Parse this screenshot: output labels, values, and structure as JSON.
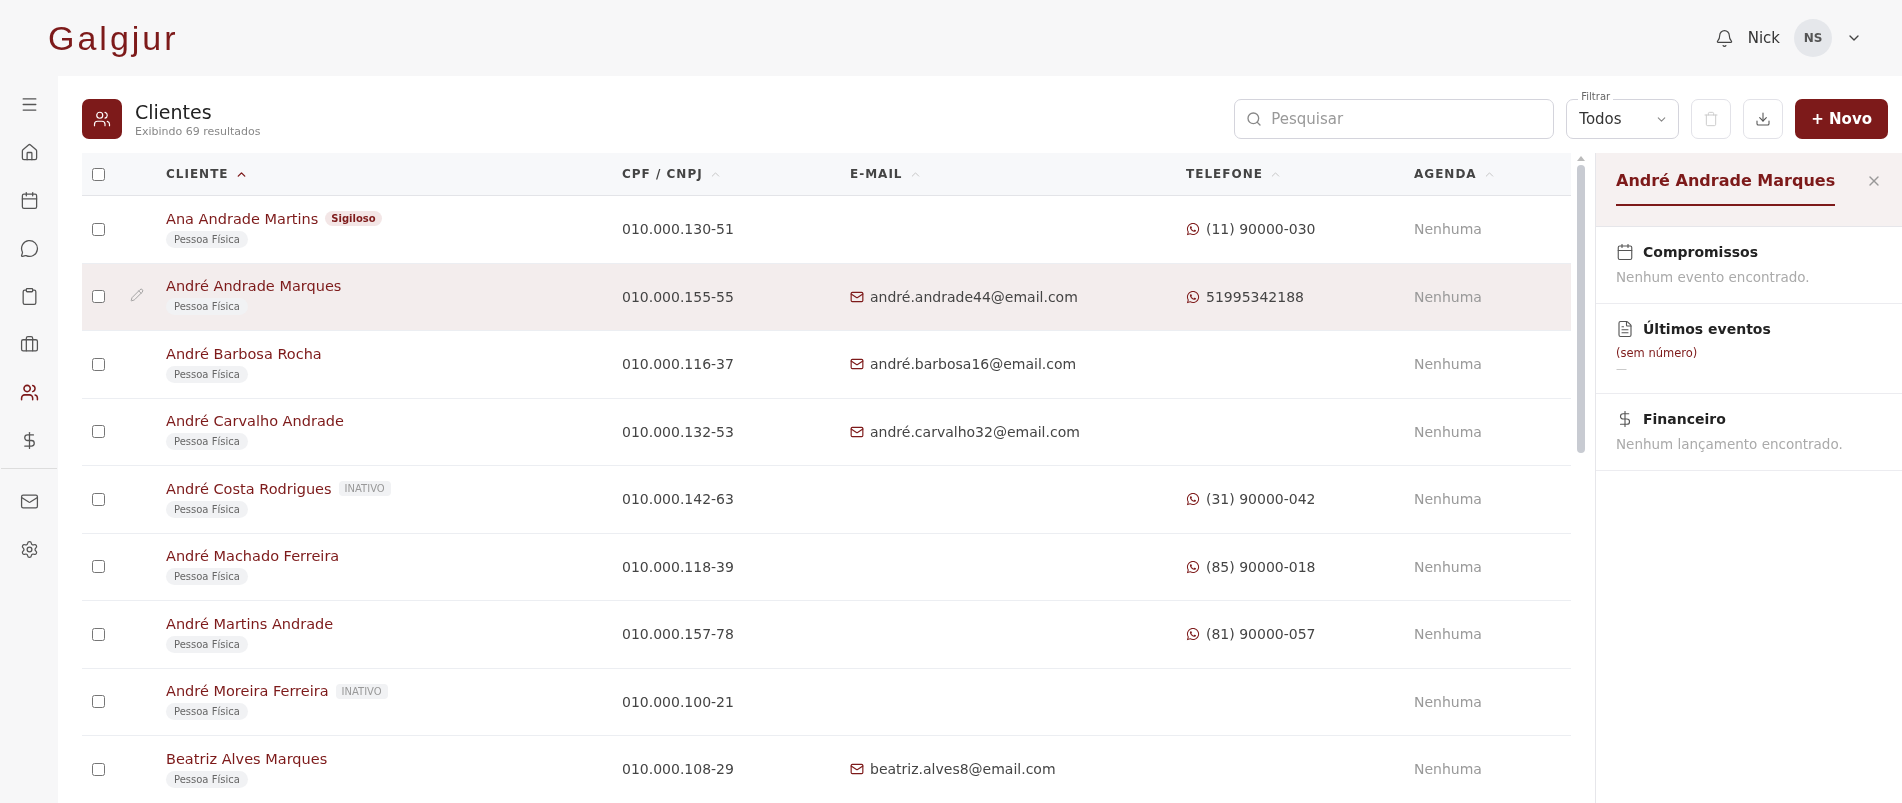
{
  "logo": "Galgjur",
  "user": {
    "name": "Nick",
    "initials": "NS"
  },
  "sidebar": {
    "items": [
      {
        "selected": false
      },
      {
        "selected": false
      },
      {
        "selected": false
      },
      {
        "selected": false
      },
      {
        "selected": false
      },
      {
        "selected": true
      },
      {
        "selected": false
      }
    ],
    "bottom_items": [
      {
        "selected": false
      },
      {
        "selected": false
      }
    ]
  },
  "page": {
    "title": "Clientes",
    "subtitle": "Exibindo 69 resultados"
  },
  "toolbar": {
    "search": {
      "placeholder": "Pesquisar"
    },
    "filter": {
      "label": "Filtrar",
      "value": "Todos"
    },
    "new_button": "+ Novo"
  },
  "table": {
    "select_all": {
      "checked": false
    },
    "columns": [
      {
        "label": "CLIENTE",
        "sorted": true
      },
      {
        "label": "CPF / CNPJ",
        "sorted": false
      },
      {
        "label": "E-MAIL",
        "sorted": false
      },
      {
        "label": "TELEFONE",
        "sorted": false
      },
      {
        "label": "AGENDA",
        "sorted": false
      }
    ],
    "rows": [
      {
        "name": "Ana Andrade Martins",
        "tag": {
          "kind": "sigiloso",
          "label": "Sigiloso"
        },
        "type": "Pessoa Física",
        "doc": "010.000.130-51",
        "phone": "(11) 90000-030",
        "agenda": "Nenhuma",
        "checked": false,
        "selected": false
      },
      {
        "name": "André Andrade Marques",
        "type": "Pessoa Física",
        "doc": "010.000.155-55",
        "email": "andré.andrade44@email.com",
        "phone": "51995342188",
        "agenda": "Nenhuma",
        "checked": false,
        "selected": true
      },
      {
        "name": "André Barbosa Rocha",
        "type": "Pessoa Física",
        "doc": "010.000.116-37",
        "email": "andré.barbosa16@email.com",
        "agenda": "Nenhuma",
        "checked": false,
        "selected": false
      },
      {
        "name": "André Carvalho Andrade",
        "type": "Pessoa Física",
        "doc": "010.000.132-53",
        "email": "andré.carvalho32@email.com",
        "agenda": "Nenhuma",
        "checked": false,
        "selected": false
      },
      {
        "name": "André Costa Rodrigues",
        "tag": {
          "kind": "inativo",
          "label": "INATIVO"
        },
        "type": "Pessoa Física",
        "doc": "010.000.142-63",
        "phone": "(31) 90000-042",
        "agenda": "Nenhuma",
        "checked": false,
        "selected": false
      },
      {
        "name": "André Machado Ferreira",
        "type": "Pessoa Física",
        "doc": "010.000.118-39",
        "phone": "(85) 90000-018",
        "agenda": "Nenhuma",
        "checked": false,
        "selected": false
      },
      {
        "name": "André Martins Andrade",
        "type": "Pessoa Física",
        "doc": "010.000.157-78",
        "phone": "(81) 90000-057",
        "agenda": "Nenhuma",
        "checked": false,
        "selected": false
      },
      {
        "name": "André Moreira Ferreira",
        "tag": {
          "kind": "inativo",
          "label": "INATIVO"
        },
        "type": "Pessoa Física",
        "doc": "010.000.100-21",
        "agenda": "Nenhuma",
        "checked": false,
        "selected": false
      },
      {
        "name": "Beatriz Alves Marques",
        "type": "Pessoa Física",
        "doc": "010.000.108-29",
        "email": "beatriz.alves8@email.com",
        "agenda": "Nenhuma",
        "checked": false,
        "selected": false
      }
    ]
  },
  "detail": {
    "title": "André Andrade Marques",
    "sections": [
      {
        "title": "Compromissos",
        "empty": "Nenhum evento encontrado."
      },
      {
        "title": "Últimos eventos",
        "link": "(sem número)",
        "dash": "—"
      },
      {
        "title": "Financeiro",
        "empty": "Nenhum lançamento encontrado."
      }
    ]
  }
}
